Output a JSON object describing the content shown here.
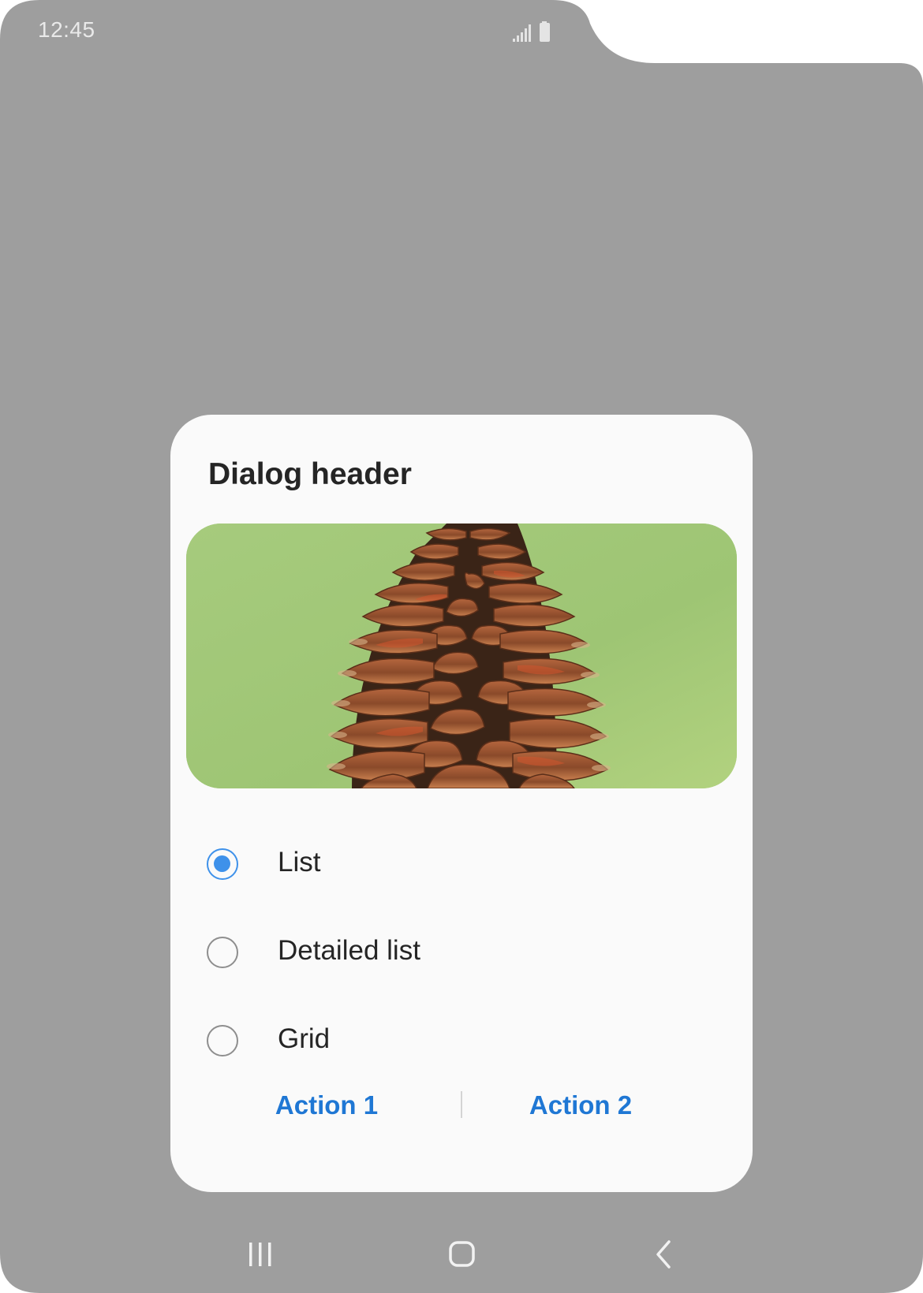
{
  "status_bar": {
    "time": "12:45",
    "icons": [
      "signal-icon",
      "battery-icon"
    ]
  },
  "colors": {
    "scrim": "#9e9e9e",
    "dialog_bg": "#fafafa",
    "accent": "#3e91ea",
    "action_text": "#1f77d4",
    "title_text": "#252525"
  },
  "dialog": {
    "title": "Dialog header",
    "image": "pine-cone-photo",
    "options": [
      {
        "label": "List",
        "checked": true
      },
      {
        "label": "Detailed list",
        "checked": false
      },
      {
        "label": "Grid",
        "checked": false
      }
    ],
    "actions": [
      {
        "label": "Action 1"
      },
      {
        "label": "Action 2"
      }
    ]
  },
  "nav_bar": {
    "buttons": [
      "recents-icon",
      "home-icon",
      "back-icon"
    ]
  }
}
